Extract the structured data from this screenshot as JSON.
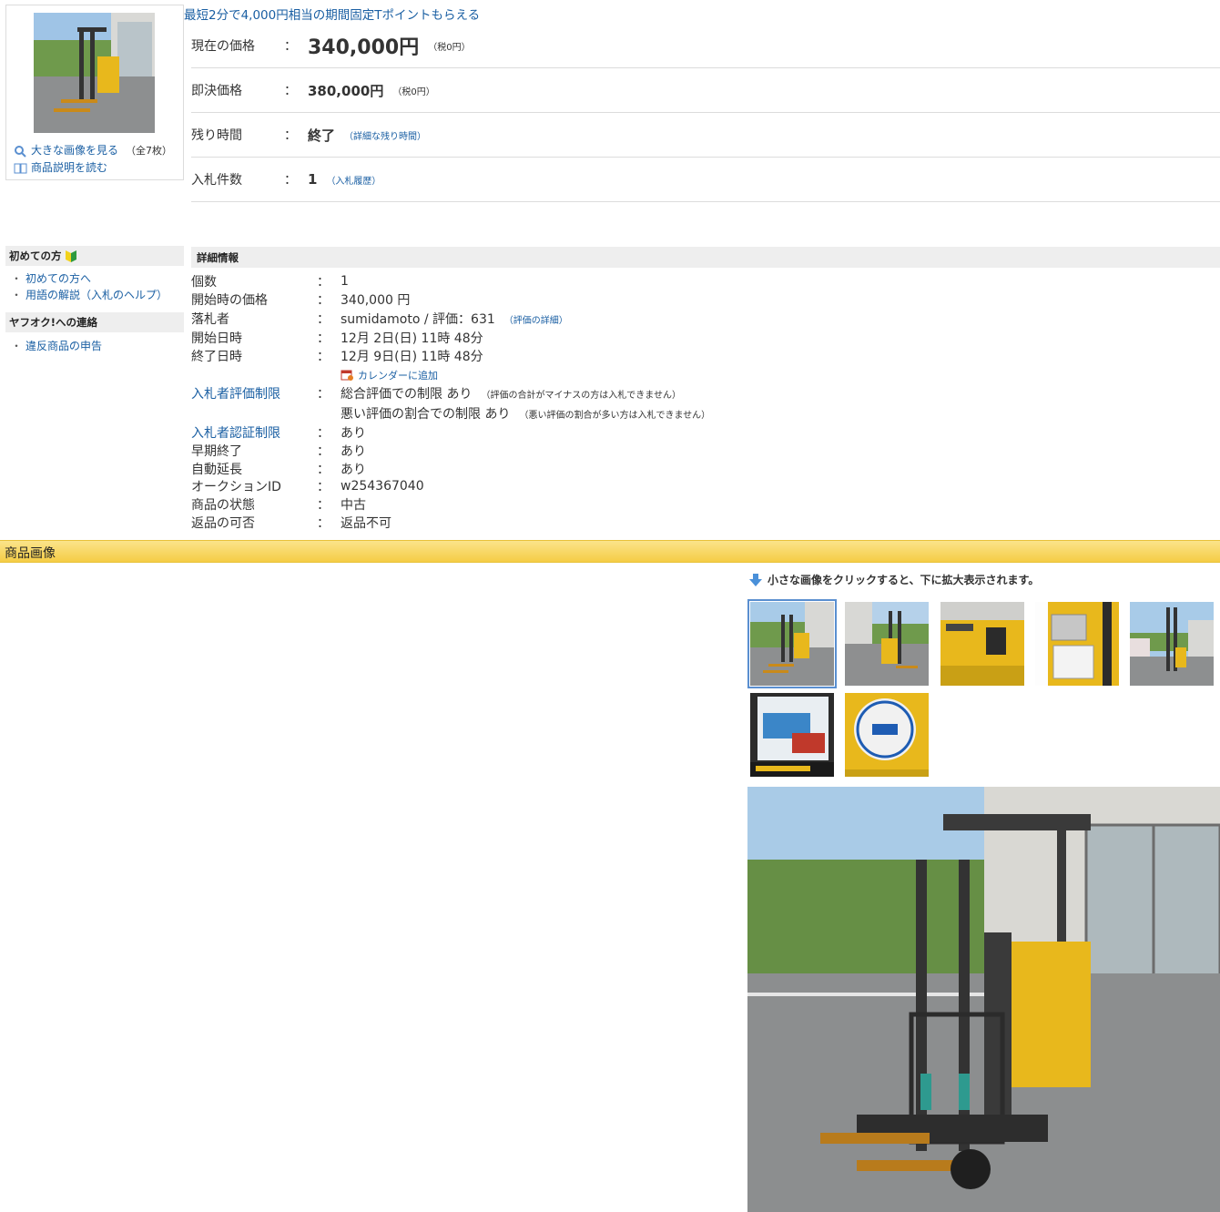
{
  "thumb": {
    "view_large": "大きな画像を見る",
    "count": "（全7枚）",
    "read_desc": "商品説明を読む"
  },
  "tpoint_link": "最短2分で4,000円相当の期間固定Tポイントもらえる",
  "prices": {
    "current": {
      "label": "現在の価格",
      "colon": "：",
      "value": "340,000円",
      "tax": "（税0円）"
    },
    "buyout": {
      "label": "即決価格",
      "colon": "：",
      "value": "380,000円",
      "tax": "（税0円）"
    },
    "remaining": {
      "label": "残り時間",
      "colon": "：",
      "value": "終了",
      "link": "（詳細な残り時間）"
    },
    "bids": {
      "label": "入札件数",
      "colon": "：",
      "value": "1",
      "link": "（入札履歴）"
    }
  },
  "sidebar": {
    "first_time_head": "初めての方",
    "links1": [
      "初めての方へ",
      "用語の解説（入札のヘルプ）"
    ],
    "contact_head": "ヤフオク!への連絡",
    "links2": [
      "違反商品の申告"
    ],
    "bullet": "・"
  },
  "detail": {
    "head": "詳細情報",
    "colon": "：",
    "rows": [
      {
        "label": "個数",
        "value": "1"
      },
      {
        "label": "開始時の価格",
        "value": "340,000 円"
      },
      {
        "label": "落札者",
        "value": "sumidamoto / 評価：631",
        "link": "（評価の詳細）"
      },
      {
        "label": "開始日時",
        "value": "12月 2日(日) 11時 48分"
      },
      {
        "label": "終了日時",
        "value": "12月 9日(日) 11時 48分"
      },
      {
        "label": "入札者評価制限",
        "value": "総合評価での制限 あり",
        "note": "（評価の合計がマイナスの方は入札できません）"
      },
      {
        "label": "",
        "value": "悪い評価の割合での制限 あり",
        "note": "（悪い評価の割合が多い方は入札できません）"
      },
      {
        "label": "入札者認証制限",
        "value": "あり"
      },
      {
        "label": "早期終了",
        "value": "あり"
      },
      {
        "label": "自動延長",
        "value": "あり"
      },
      {
        "label": "オークションID",
        "value": "w254367040"
      },
      {
        "label": "商品の状態",
        "value": "中古"
      },
      {
        "label": "返品の可否",
        "value": "返品不可"
      }
    ],
    "calendar": "カレンダーに追加"
  },
  "images_section": {
    "title": "商品画像",
    "hint": "小さな画像をクリックすると、下に拡大表示されます。"
  },
  "colors": {
    "link": "#1a5fa3",
    "section_bar": "#f5cd45",
    "forklift_yellow": "#e8b81c",
    "header_gray": "#eeeeee"
  }
}
